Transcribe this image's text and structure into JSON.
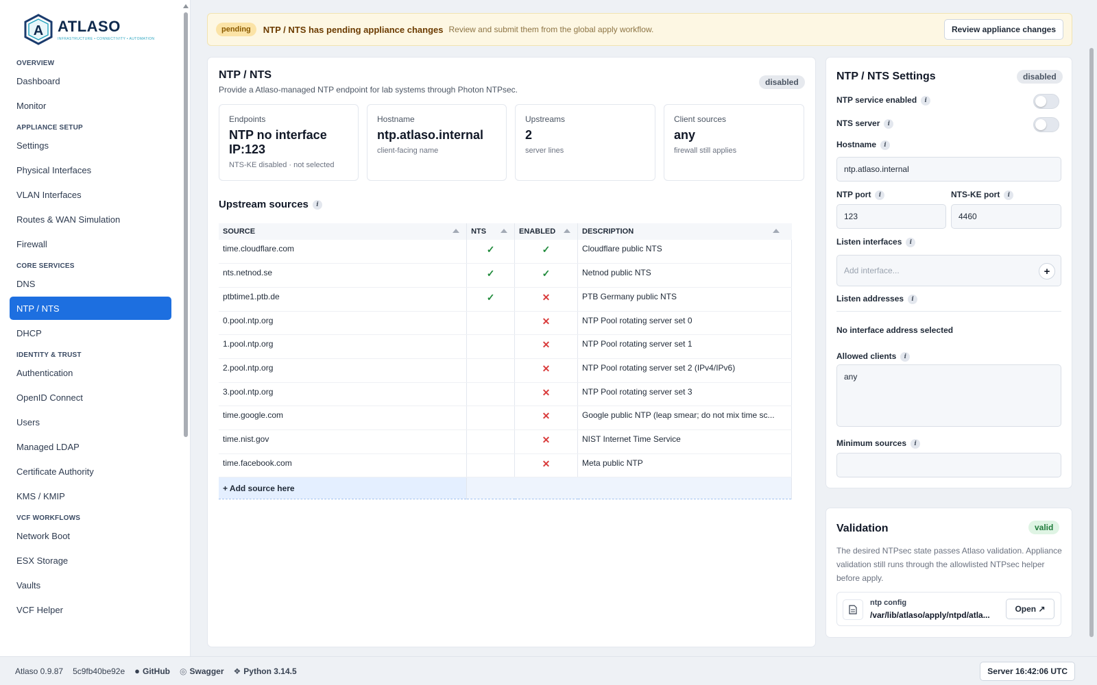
{
  "brand": {
    "name": "ATLASO",
    "tagline": "INFRASTRUCTURE • CONNECTIVITY • AUTOMATION",
    "primary_color": "#1d6fe0"
  },
  "sidebar": {
    "sections": [
      {
        "title": "OVERVIEW",
        "items": [
          "Dashboard",
          "Monitor"
        ]
      },
      {
        "title": "APPLIANCE SETUP",
        "items": [
          "Settings",
          "Physical Interfaces",
          "VLAN Interfaces",
          "Routes & WAN Simulation",
          "Firewall"
        ]
      },
      {
        "title": "CORE SERVICES",
        "items": [
          "DNS",
          "NTP / NTS",
          "DHCP"
        ]
      },
      {
        "title": "IDENTITY & TRUST",
        "items": [
          "Authentication",
          "OpenID Connect",
          "Users",
          "Managed LDAP",
          "Certificate Authority",
          "KMS / KMIP"
        ]
      },
      {
        "title": "VCF WORKFLOWS",
        "items": [
          "Network Boot",
          "ESX Storage",
          "Vaults",
          "VCF Helper"
        ]
      }
    ],
    "active_item": "NTP / NTS"
  },
  "banner": {
    "pill": "pending",
    "title": "NTP / NTS has pending appliance changes",
    "subtitle": "Review and submit them from the global apply workflow.",
    "button": "Review appliance changes"
  },
  "main": {
    "title": "NTP / NTS",
    "subtitle": "Provide a Atlaso-managed NTP endpoint for lab systems through Photon NTPsec.",
    "status": "disabled",
    "stats": [
      {
        "label": "Endpoints",
        "value": "NTP no interface IP:123",
        "sub": "NTS-KE disabled · not selected"
      },
      {
        "label": "Hostname",
        "value": "ntp.atlaso.internal",
        "sub": "client-facing name"
      },
      {
        "label": "Upstreams",
        "value": "2",
        "sub": "server lines"
      },
      {
        "label": "Client sources",
        "value": "any",
        "sub": "firewall still applies"
      }
    ],
    "upstream_title": "Upstream sources",
    "columns": [
      "SOURCE",
      "NTS",
      "ENABLED",
      "DESCRIPTION"
    ],
    "rows": [
      {
        "source": "time.cloudflare.com",
        "nts": "✓",
        "enabled": "✓",
        "description": "Cloudflare public NTS"
      },
      {
        "source": "nts.netnod.se",
        "nts": "✓",
        "enabled": "✓",
        "description": "Netnod public NTS"
      },
      {
        "source": "ptbtime1.ptb.de",
        "nts": "✓",
        "enabled": "✕",
        "description": "PTB Germany public NTS"
      },
      {
        "source": "0.pool.ntp.org",
        "nts": "",
        "enabled": "✕",
        "description": "NTP Pool rotating server set 0"
      },
      {
        "source": "1.pool.ntp.org",
        "nts": "",
        "enabled": "✕",
        "description": "NTP Pool rotating server set 1"
      },
      {
        "source": "2.pool.ntp.org",
        "nts": "",
        "enabled": "✕",
        "description": "NTP Pool rotating server set 2 (IPv4/IPv6)"
      },
      {
        "source": "3.pool.ntp.org",
        "nts": "",
        "enabled": "✕",
        "description": "NTP Pool rotating server set 3"
      },
      {
        "source": "time.google.com",
        "nts": "",
        "enabled": "✕",
        "description": "Google public NTP (leap smear; do not mix time sc..."
      },
      {
        "source": "time.nist.gov",
        "nts": "",
        "enabled": "✕",
        "description": "NIST Internet Time Service"
      },
      {
        "source": "time.facebook.com",
        "nts": "",
        "enabled": "✕",
        "description": "Meta public NTP"
      }
    ],
    "add_source": "+ Add source here"
  },
  "settings": {
    "title": "NTP / NTS Settings",
    "status": "disabled",
    "ntp_enabled_label": "NTP service enabled",
    "nts_server_label": "NTS server",
    "hostname_label": "Hostname",
    "hostname_value": "ntp.atlaso.internal",
    "ntp_port_label": "NTP port",
    "ntp_port_value": "123",
    "ntske_port_label": "NTS-KE port",
    "ntske_port_value": "4460",
    "listen_interfaces_label": "Listen interfaces",
    "listen_interfaces_placeholder": "Add interface...",
    "listen_addresses_label": "Listen addresses",
    "no_address": "No interface address selected",
    "allowed_clients_label": "Allowed clients",
    "allowed_clients_value": "any",
    "min_sources_label": "Minimum sources",
    "min_sources_value": ""
  },
  "validation": {
    "title": "Validation",
    "status": "valid",
    "text": "The desired NTPsec state passes Atlaso validation. Appliance validation still runs through the allowlisted NTPsec helper before apply.",
    "file_label": "ntp config",
    "file_path": "/var/lib/atlaso/apply/ntpd/atla...",
    "open_button": "Open ↗"
  },
  "footer": {
    "version": "Atlaso 0.9.87",
    "commit": "5c9fb40be92e",
    "github": "GitHub",
    "swagger": "Swagger",
    "python": "Python 3.14.5",
    "server_time": "Server 16:42:06 UTC"
  }
}
